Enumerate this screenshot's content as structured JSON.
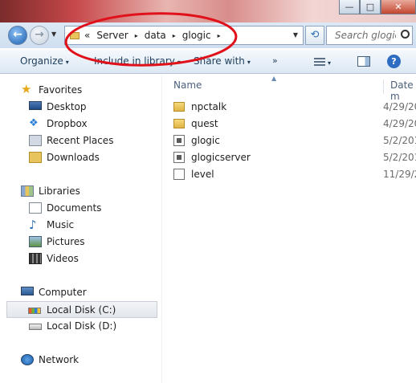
{
  "window": {
    "controls": [
      {
        "name": "minimize-button",
        "glyph": "—"
      },
      {
        "name": "maximize-button",
        "glyph": "□"
      },
      {
        "name": "close-button",
        "glyph": "✕"
      }
    ]
  },
  "address": {
    "overflow": "«",
    "crumbs": [
      "Server",
      "data",
      "glogic"
    ],
    "separator": "▸"
  },
  "search": {
    "placeholder": "Search glogic"
  },
  "toolbar": {
    "organize": "Organize",
    "include": "Include in library",
    "share": "Share with",
    "more": "»",
    "dropdown": "▾"
  },
  "nav": {
    "favorites": {
      "label": "Favorites",
      "icon": "star-icon"
    },
    "favorite_items": [
      {
        "label": "Desktop",
        "icon": "desktop-icon"
      },
      {
        "label": "Dropbox",
        "icon": "dropbox-icon"
      },
      {
        "label": "Recent Places",
        "icon": "recent-places-icon"
      },
      {
        "label": "Downloads",
        "icon": "downloads-icon"
      }
    ],
    "libraries": {
      "label": "Libraries",
      "icon": "libraries-icon"
    },
    "library_items": [
      {
        "label": "Documents",
        "icon": "documents-icon"
      },
      {
        "label": "Music",
        "icon": "music-icon"
      },
      {
        "label": "Pictures",
        "icon": "pictures-icon"
      },
      {
        "label": "Videos",
        "icon": "videos-icon"
      }
    ],
    "computer": {
      "label": "Computer",
      "icon": "computer-icon"
    },
    "drives": [
      {
        "label": "Local Disk (C:)",
        "icon": "disk-icon",
        "selected": true
      },
      {
        "label": "Local Disk (D:)",
        "icon": "disk-icon",
        "selected": false
      }
    ],
    "network": {
      "label": "Network",
      "icon": "network-icon"
    }
  },
  "files": {
    "columns": {
      "name": "Name",
      "date": "Date m"
    },
    "rows": [
      {
        "name": "npctalk",
        "type": "folder",
        "date": "4/29/20"
      },
      {
        "name": "quest",
        "type": "folder",
        "date": "4/29/20"
      },
      {
        "name": "glogic",
        "type": "file",
        "date": "5/2/201"
      },
      {
        "name": "glogicserver",
        "type": "file",
        "date": "5/2/201"
      },
      {
        "name": "level",
        "type": "plain",
        "date": "11/29/2"
      }
    ]
  },
  "annotation": {
    "color": "#e0111a"
  }
}
